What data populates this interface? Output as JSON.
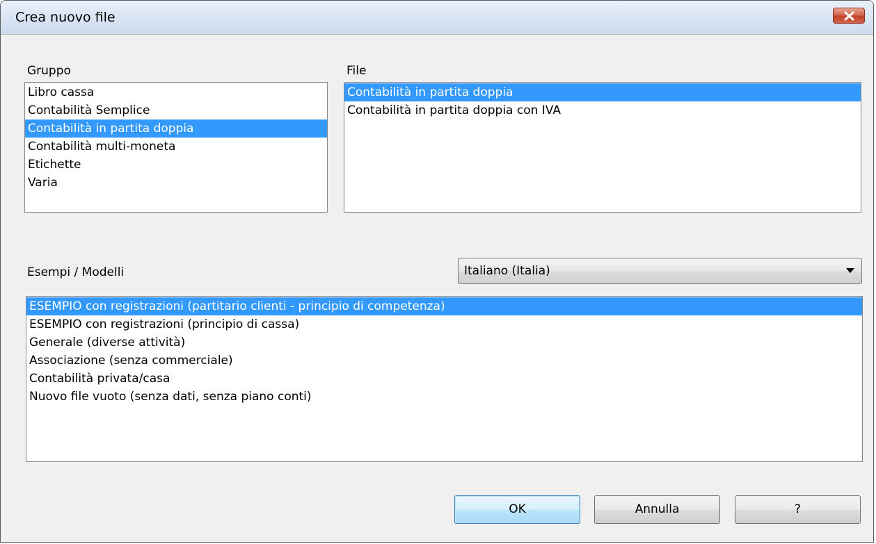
{
  "window": {
    "title": "Crea nuovo file",
    "close_icon": "close-icon"
  },
  "gruppo": {
    "label": "Gruppo",
    "items": [
      "Libro cassa",
      "Contabilità Semplice",
      "Contabilità in partita doppia",
      "Contabilità multi-moneta",
      "Etichette",
      "Varia"
    ],
    "selected": "Contabilità in partita doppia"
  },
  "file": {
    "label": "File",
    "items": [
      "Contabilità in partita doppia",
      "Contabilità in partita doppia con IVA"
    ],
    "selected": "Contabilità in partita doppia"
  },
  "esempi": {
    "label": "Esempi / Modelli",
    "language": "Italiano (Italia)",
    "items": [
      "ESEMPIO con registrazioni (partitario clienti - principio di competenza)",
      "ESEMPIO con registrazioni (principio di cassa)",
      "Generale (diverse attività)",
      "Associazione (senza commerciale)",
      "Contabilità privata/casa",
      "Nuovo file vuoto (senza dati, senza piano conti)"
    ],
    "selected": "ESEMPIO con registrazioni (partitario clienti - principio di competenza)"
  },
  "buttons": {
    "ok": "OK",
    "cancel": "Annulla",
    "help": "?"
  },
  "colors": {
    "selection": "#3399ff",
    "close_button": "#c2432a"
  }
}
